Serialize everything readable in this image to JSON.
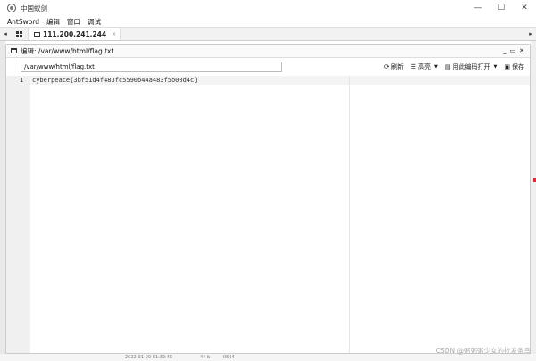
{
  "window": {
    "title": "中国蚁剑",
    "controls": [
      "—",
      "☐",
      "✕"
    ]
  },
  "menu": [
    "AntSword",
    "编辑",
    "窗口",
    "调试"
  ],
  "tabs": {
    "home_icon": "grid-icon",
    "active_tab": "111.200.241.244",
    "active_close": "×"
  },
  "panel": {
    "title": "编辑: /var/www/html/flag.txt",
    "controls": [
      "_",
      "▭",
      "✕"
    ],
    "path_value": "/var/www/html/flag.txt",
    "tools": {
      "refresh": "刷新",
      "highlight": "高亮",
      "encoding": "用此编码打开",
      "save": "保存"
    }
  },
  "editor": {
    "line_number": "1",
    "line_text": "cyberpeace{3bf51d4f483fc5590b44a483f5b00d4c}"
  },
  "background": {
    "date": "2022-01-20 01:32:40",
    "size": "44 b",
    "perm": "0664"
  },
  "watermark": "CSDN @粥粥粥少女的拧发条鸟"
}
